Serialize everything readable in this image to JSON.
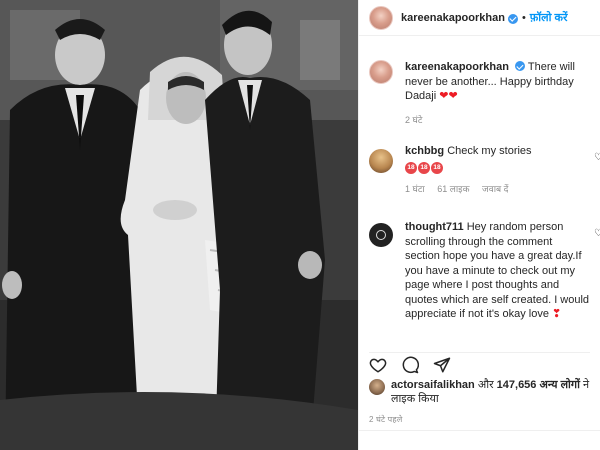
{
  "header": {
    "username": "kareenakapoorkhan",
    "separator": "•",
    "follow_label": "फ़ॉलो करें"
  },
  "caption": {
    "username": "kareenakapoorkhan",
    "text": "There will never be another... Happy birthday Dadaji",
    "emoji": "❤❤",
    "time": "2 घंटे"
  },
  "comments": [
    {
      "username": "kchbbg",
      "text": "Check my stories",
      "badges": [
        "18",
        "18",
        "18"
      ],
      "time": "1 घंटा",
      "likes": "61 लाइक",
      "reply": "जवाब दें"
    },
    {
      "username": "thought711",
      "text": "Hey random person scrolling through the comment section hope you have a great day.If you have a minute to check out my page where I post thoughts and quotes which are self created. I would appreciate if not it's okay love",
      "emoji": "❣"
    }
  ],
  "likes": {
    "username": "actorsaifalikhan",
    "joiner": "और",
    "count": "147,656",
    "others": "अन्य लोगों",
    "suffix": "ने लाइक किया"
  },
  "post_time": "2 घंटे पहले",
  "icons": {
    "like": "heart-icon",
    "comment": "comment-icon",
    "share": "share-icon"
  },
  "colors": {
    "accent": "#0095f6",
    "verified": "#3897f0",
    "heart": "#ed1c24"
  }
}
